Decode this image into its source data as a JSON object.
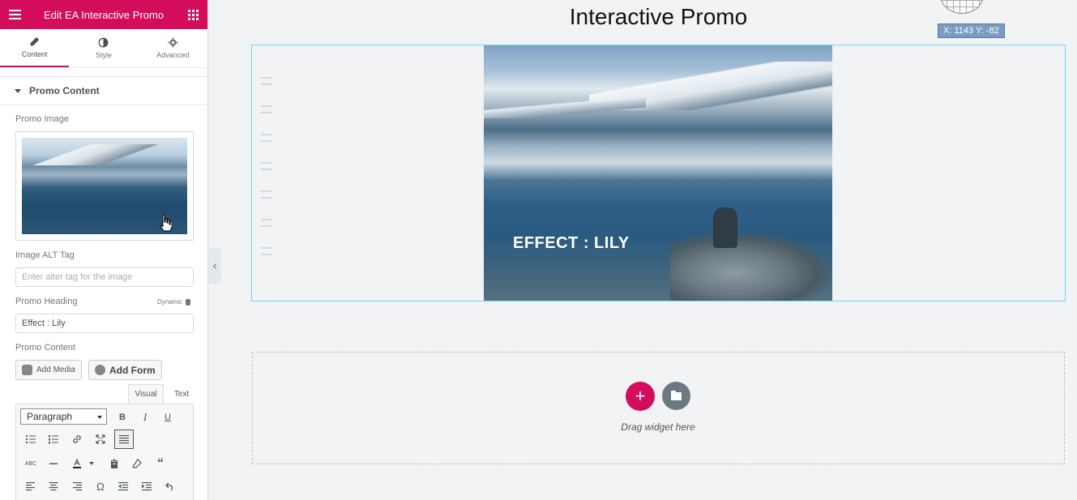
{
  "topbar": {
    "title": "Edit EA Interactive Promo",
    "menu_icon": "hamburger-icon",
    "apps_icon": "grid-icon"
  },
  "tabs": [
    {
      "label": "Content",
      "icon": "pencil-icon",
      "active": true
    },
    {
      "label": "Style",
      "icon": "contrast-icon",
      "active": false
    },
    {
      "label": "Advanced",
      "icon": "gear-icon",
      "active": false
    }
  ],
  "section": {
    "title": "Promo Content"
  },
  "controls": {
    "promo_image_label": "Promo Image",
    "alt_label": "Image ALT Tag",
    "alt_placeholder": "Enter alter tag for the image",
    "heading_label": "Promo Heading",
    "dynamic_label": "Dynamic",
    "heading_value": "Effect : Lily",
    "content_label": "Promo Content"
  },
  "editor": {
    "add_media": "Add Media",
    "add_form": "Add Form",
    "tab_visual": "Visual",
    "tab_text": "Text",
    "format_value": "Paragraph",
    "bold": "B",
    "italic": "I",
    "underline": "U",
    "abc": "ABC",
    "omega": "Ω",
    "quote": "“"
  },
  "canvas": {
    "page_title": "Interactive Promo",
    "coords": "X: 1143 Y: -82",
    "promo_heading": "EFFECT : LILY",
    "drag_text": "Drag widget here",
    "add_symbol": "+"
  },
  "colors": {
    "brand": "#d30c5c",
    "selection": "#71d7f7",
    "muted": "#6d7882"
  }
}
